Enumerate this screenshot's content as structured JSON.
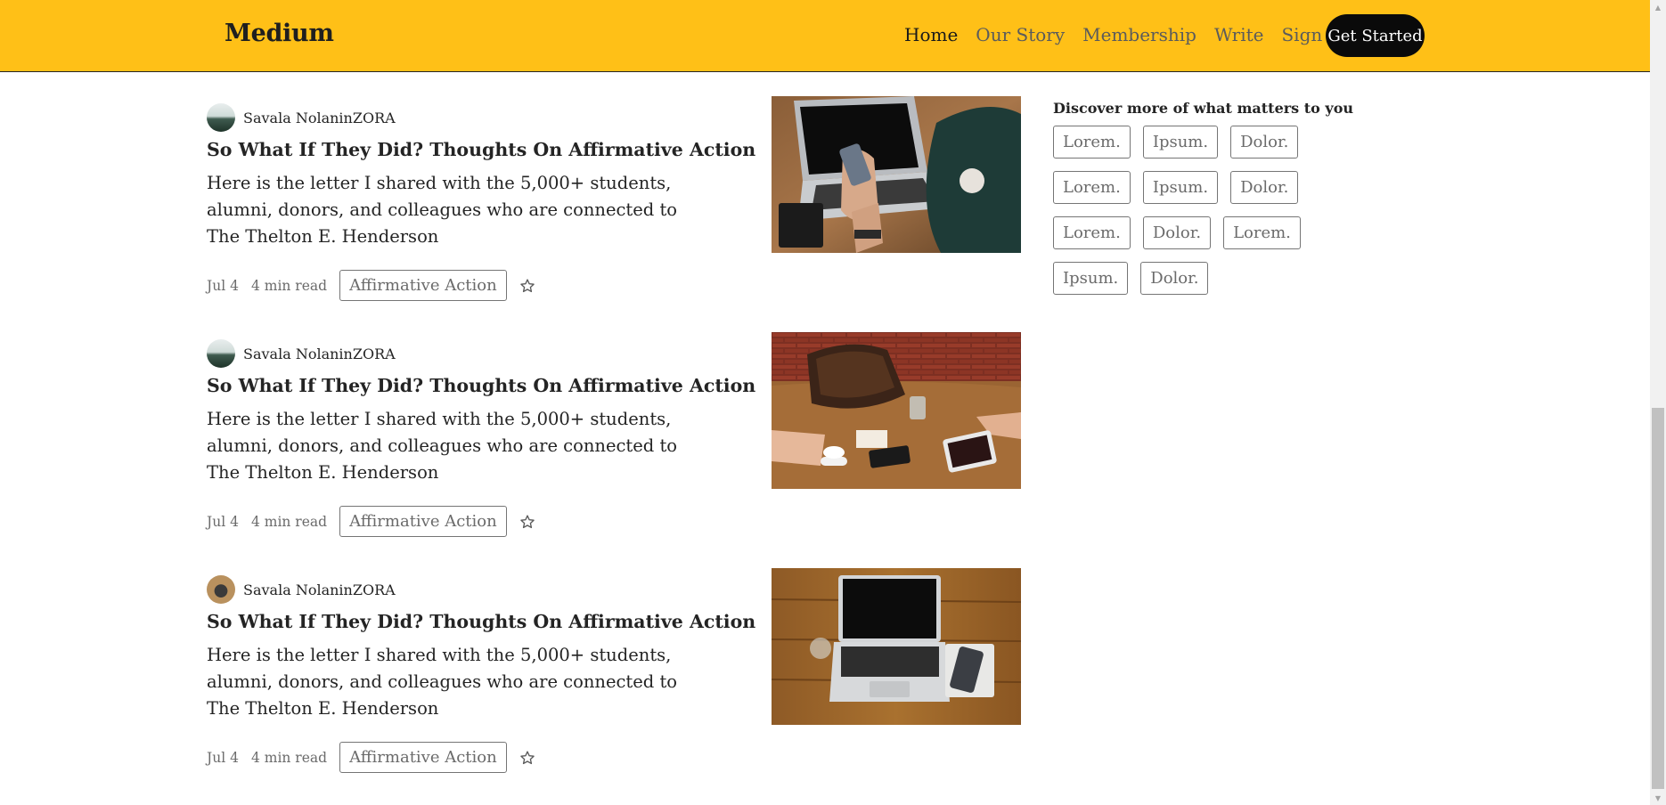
{
  "header": {
    "logo": "Medium",
    "nav": [
      "Home",
      "Our Story",
      "Membership",
      "Write",
      "Sign In"
    ],
    "cta": "Get Started",
    "bg_color": "#ffc017"
  },
  "articles": [
    {
      "author": "Savala NolaninZORA",
      "avatar": "mountain-avatar",
      "title": "So What If They Did? Thoughts On Affirmative Action",
      "excerpt": "Here is the letter I shared with the 5,000+ students, alumni, donors, and colleagues who are connected to The Thelton E. Henderson",
      "date": "Jul 4",
      "read_time": "4 min read",
      "tag": "Affirmative Action",
      "image": "laptop-phone-photo"
    },
    {
      "author": "Savala NolaninZORA",
      "avatar": "mountain-avatar",
      "title": "So What If They Did? Thoughts On Affirmative Action",
      "excerpt": "Here is the letter I shared with the 5,000+ students, alumni, donors, and colleagues who are connected to The Thelton E. Henderson",
      "date": "Jul 4",
      "read_time": "4 min read",
      "tag": "Affirmative Action",
      "image": "meeting-table-photo"
    },
    {
      "author": "Savala NolaninZORA",
      "avatar": "laptop-avatar",
      "title": "So What If They Did? Thoughts On Affirmative Action",
      "excerpt": "Here is the letter I shared with the 5,000+ students, alumni, donors, and colleagues who are connected to The Thelton E. Henderson",
      "date": "Jul 4",
      "read_time": "4 min read",
      "tag": "Affirmative Action",
      "image": "laptop-desk-photo"
    }
  ],
  "sidebar": {
    "title": "Discover more of what matters to you",
    "topics": [
      "Lorem.",
      "Ipsum.",
      "Dolor.",
      "Lorem.",
      "Ipsum.",
      "Dolor.",
      "Lorem.",
      "Dolor.",
      "Lorem.",
      "Ipsum.",
      "Dolor."
    ]
  }
}
